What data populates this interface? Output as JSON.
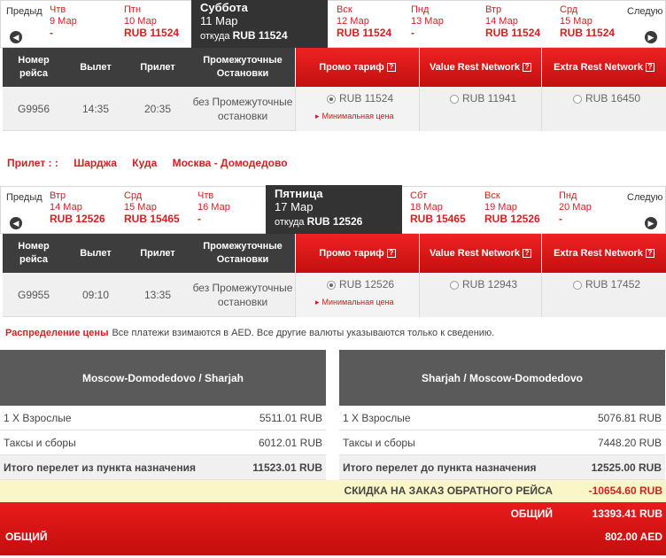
{
  "outbound": {
    "prev_label": "Предыд",
    "next_label": "Следую",
    "dates": [
      {
        "day": "Чтв",
        "date": "9 Мар",
        "price": "-"
      },
      {
        "day": "Птн",
        "date": "10 Мар",
        "price": "RUB 11524"
      },
      {
        "day": "Вск",
        "date": "12 Мар",
        "price": "RUB 11524"
      },
      {
        "day": "Пнд",
        "date": "13 Мар",
        "price": "-"
      },
      {
        "day": "Втр",
        "date": "14 Мар",
        "price": "RUB 11524"
      },
      {
        "day": "Срд",
        "date": "15 Мар",
        "price": "RUB 11524"
      }
    ],
    "selected": {
      "day": "Суббота",
      "date": "11 Мар",
      "from": "откуда",
      "price": "RUB 11524"
    },
    "headers": {
      "flight": "Номер рейса",
      "dep": "Вылет",
      "arr": "Прилет",
      "stops": "Промежуточные Остановки"
    },
    "fares": [
      "Промо тариф",
      "Value Rest Network",
      "Extra Rest Network"
    ],
    "flight": {
      "number": "G9956",
      "dep": "14:35",
      "arr": "20:35",
      "stops": "без Промежуточные остановки"
    },
    "prices": [
      "RUB 11524",
      "RUB 11941",
      "RUB 16450"
    ],
    "min_label": "Минимальная цена"
  },
  "arrival": {
    "label": "Прилет : :",
    "city": "Шарджа",
    "to": "Куда",
    "dest": "Москва - Домодедово"
  },
  "return": {
    "prev_label": "Предыд",
    "next_label": "Следую",
    "dates": [
      {
        "day": "Втр",
        "date": "14 Мар",
        "price": "RUB 12526"
      },
      {
        "day": "Срд",
        "date": "15 Мар",
        "price": "RUB 15465"
      },
      {
        "day": "Чтв",
        "date": "16 Мар",
        "price": "-"
      },
      {
        "day": "Сбт",
        "date": "18 Мар",
        "price": "RUB 15465"
      },
      {
        "day": "Вск",
        "date": "19 Мар",
        "price": "RUB 12526"
      },
      {
        "day": "Пнд",
        "date": "20 Мар",
        "price": "-"
      }
    ],
    "selected": {
      "day": "Пятница",
      "date": "17 Мар",
      "from": "откуда",
      "price": "RUB 12526"
    },
    "headers": {
      "flight": "Номер рейса",
      "dep": "Вылет",
      "arr": "Прилет",
      "stops": "Промежуточные Остановки"
    },
    "fares": [
      "Промо тариф",
      "Value Rest Network",
      "Extra Rest Network"
    ],
    "flight": {
      "number": "G9955",
      "dep": "09:10",
      "arr": "13:35",
      "stops": "без Промежуточные остановки"
    },
    "prices": [
      "RUB 12526",
      "RUB 12943",
      "RUB 17452"
    ],
    "min_label": "Минимальная цена"
  },
  "price_distribution": {
    "title": "Распределение цены",
    "note": "Все платежи взимаются в AED. Все другие валюты указываются только к сведению.",
    "left": {
      "route": "Moscow-Domodedovo / Sharjah",
      "adults_label": "1 X Взрослые",
      "adults_value": "5511.01 RUB",
      "taxes_label": "Таксы и сборы",
      "taxes_value": "6012.01 RUB",
      "total_label": "Итого перелет из пункта назначения",
      "total_value": "11523.01 RUB"
    },
    "right": {
      "route": "Sharjah / Moscow-Domodedovo",
      "adults_label": "1 X Взрослые",
      "adults_value": "5076.81 RUB",
      "taxes_label": "Таксы и сборы",
      "taxes_value": "7448.20 RUB",
      "total_label": "Итого перелет до пункта назначения",
      "total_value": "12525.00 RUB"
    },
    "discount_label": "СКИДКА НА ЗАКАЗ ОБРАТНОГО РЕЙСА",
    "discount_value": "-10654.60 RUB",
    "total_label": "ОБЩИЙ",
    "total_value": "13393.41 RUB",
    "total_aed_label": "ОБЩИЙ",
    "total_aed_value": "802.00 AED"
  }
}
